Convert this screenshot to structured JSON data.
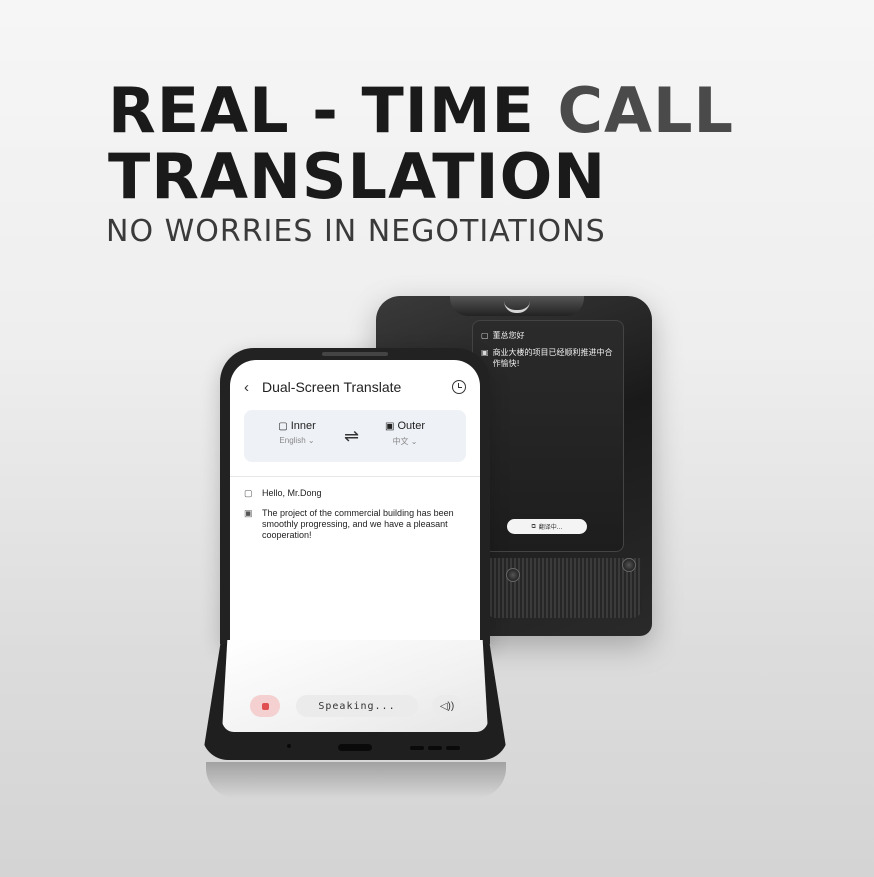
{
  "headline": {
    "line1_a": "REAL - TIME ",
    "line1_b": "CALL",
    "line2": "TRANSLATION",
    "subtitle": "NO WORRIES IN NEGOTIATIONS"
  },
  "app": {
    "title": "Dual-Screen Translate",
    "inner_label": "Inner",
    "inner_language": "English",
    "outer_label": "Outer",
    "outer_language": "中文",
    "messages": [
      {
        "text": "Hello, Mr.Dong"
      },
      {
        "text": "The project of the commercial building has been smoothly progressing, and we have a pleasant cooperation!"
      }
    ],
    "speaking_label": "Speaking..."
  },
  "outer_screen": {
    "messages": [
      {
        "text": "董总您好"
      },
      {
        "text": "商业大楼的项目已经顺利推进中合作愉快!"
      }
    ],
    "status_label": "翻译中..."
  },
  "icons": {
    "back": "chevron-left-icon",
    "history": "history-icon",
    "swap": "swap-icon",
    "inner_device": "phone-icon",
    "outer_device": "phone-outer-icon",
    "record": "record-icon",
    "speaker": "speaker-icon"
  },
  "colors": {
    "record_accent": "#e05050",
    "lang_card_bg": "#eef1f6"
  }
}
